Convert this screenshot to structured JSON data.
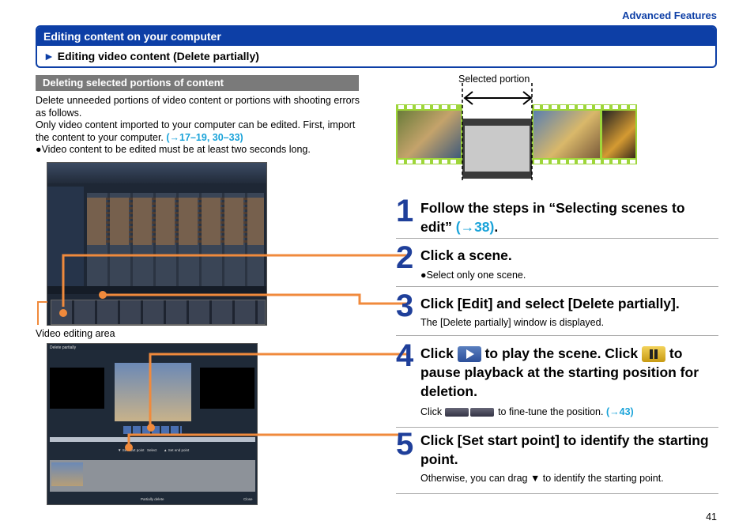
{
  "header": {
    "section": "Advanced Features"
  },
  "banner": {
    "title": "Editing content on your computer",
    "subtitle_marker": "►",
    "subtitle": "Editing video content (Delete partially)"
  },
  "section_heading": "Deleting selected portions of content",
  "intro": {
    "p1": "Delete unneeded portions of video content or portions with shooting errors as follows.",
    "p2": "Only video content imported to your computer can be edited. First, import the content to your computer.",
    "p2_link": "(→17–19, 30–33)",
    "bullet_marker": "●",
    "bullet": "Video content to be edited must be at least two seconds long."
  },
  "captions": {
    "video_editing_area": "Video editing area",
    "selected_portion": "Selected portion"
  },
  "dialog": {
    "title": "Delete partially",
    "set_start": "▼ Set start point",
    "select": "Select",
    "set_end": "▲ Set end point",
    "partially_delete": "Partially delete",
    "close": "Close"
  },
  "steps": [
    {
      "num": "1",
      "title": "Follow the steps in “Selecting scenes to edit”",
      "link": "(→38)",
      "end": "."
    },
    {
      "num": "2",
      "title": "Click a scene.",
      "note_marker": "●",
      "note": "Select only one scene."
    },
    {
      "num": "3",
      "title": "Click [Edit] and select [Delete partially].",
      "note": "The [Delete partially] window is displayed."
    },
    {
      "num": "4",
      "title_a": "Click",
      "title_b": "to play the scene. Click",
      "title_c": "to",
      "title_d": "pause playback at the starting position for deletion.",
      "note_a": "Click",
      "note_b": "to fine-tune the position.",
      "note_link": "(→43)"
    },
    {
      "num": "5",
      "title": "Click [Set start point] to identify the starting point.",
      "note": "Otherwise, you can drag ▼ to identify the starting point."
    }
  ],
  "page_number": "41",
  "colors": {
    "brand_blue": "#0d3fa6",
    "link_cyan": "#1aa3d9",
    "callout_orange": "#f08a3c",
    "film_green": "#9ed63a"
  }
}
